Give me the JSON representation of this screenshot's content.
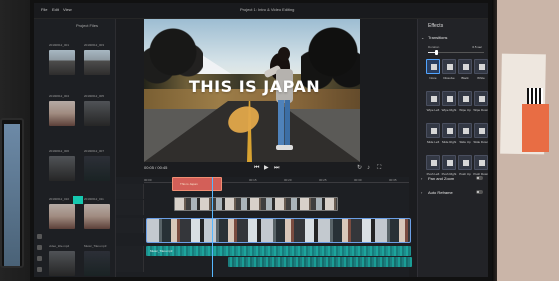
{
  "window": {
    "menu": [
      "File",
      "Edit",
      "View"
    ],
    "title": "Project 1: Intro & Video Editing"
  },
  "media": {
    "heading": "Project Files",
    "clips": [
      {
        "label": "20190612_001",
        "style": "thumb-road"
      },
      {
        "label": "20190612_003",
        "style": "thumb-road"
      },
      {
        "label": "20190612_004",
        "style": "thumb-warm"
      },
      {
        "label": "20190612_005",
        "style": "thumb-dark"
      },
      {
        "label": "20190612_006",
        "style": "thumb-dark"
      },
      {
        "label": "20190612_007",
        "style": "thumb-teal"
      },
      {
        "label": "20190612_010",
        "style": "thumb-warm"
      },
      {
        "label": "20190612_011",
        "style": "thumb-warm"
      },
      {
        "label": "video_title.mp4",
        "style": "thumb-dark"
      },
      {
        "label": "Music_Tiles.mp3",
        "style": "thumb-teal"
      }
    ]
  },
  "viewer": {
    "title_overlay": "THIS IS JAPAN",
    "timecode": "00:05 / 00:45"
  },
  "timeline": {
    "ruler_ticks": [
      "00:00",
      "00:05",
      "00:10",
      "00:15",
      "00:20",
      "00:25",
      "00:30",
      "00:35"
    ],
    "title_clip": "This is Japan",
    "audio_clip": "Music_Tiles.mp3"
  },
  "effects": {
    "title": "Effects",
    "transitions_title": "Transitions",
    "duration_label": "Duration",
    "duration_value": "0.5 sec",
    "transitions": [
      "None",
      "Dissolve",
      "Black",
      "White",
      "Wipe Left",
      "Wipe Right",
      "Wipe Up",
      "Wipe Down",
      "Slide Left",
      "Slide Right",
      "Slide Up",
      "Slide Down",
      "Push Left",
      "Push Right",
      "Push Up",
      "Push Down"
    ],
    "pan_zoom": "Pan and Zoom",
    "auto_reframe": "Auto Reframe"
  }
}
